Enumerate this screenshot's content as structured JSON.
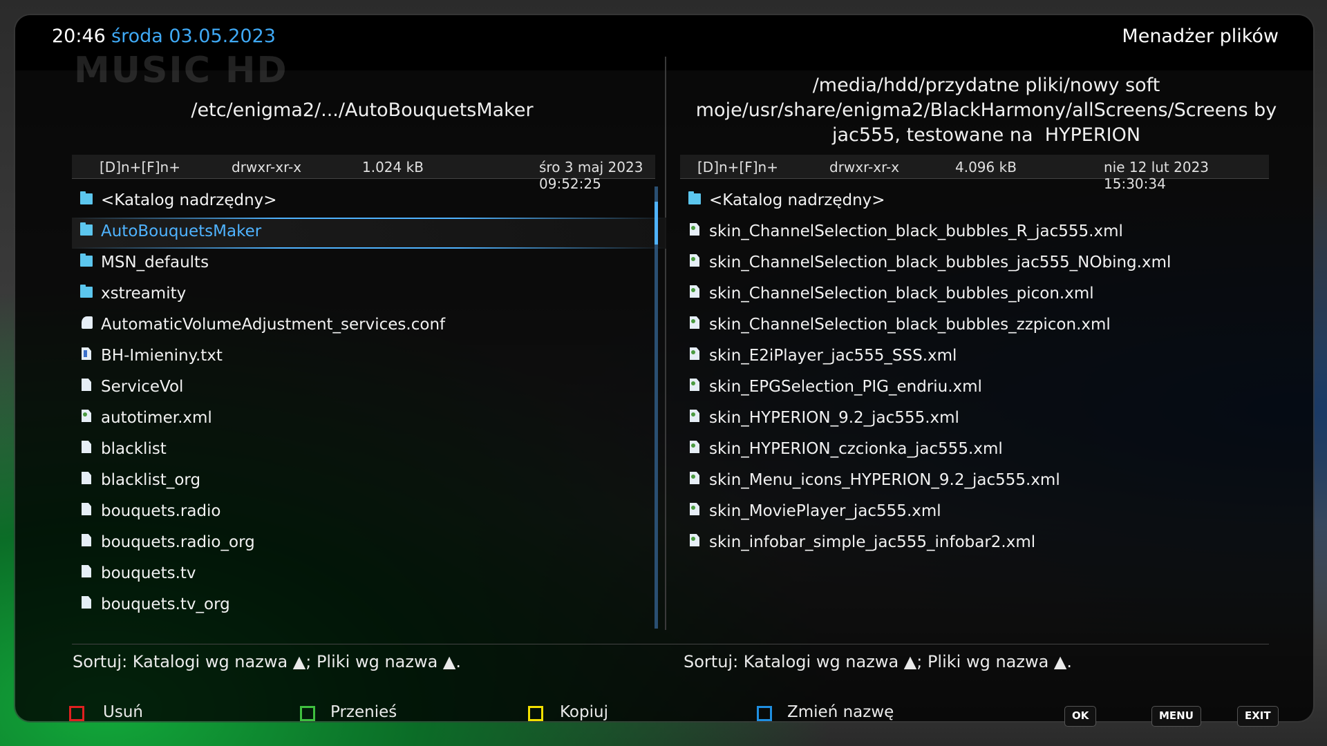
{
  "header": {
    "time": "20:46",
    "date": "środa 03.05.2023",
    "title": "Menadżer plików",
    "watermark": "MUSIC HD"
  },
  "left_pane": {
    "path": "/etc/enigma2/.../AutoBouquetsMaker",
    "info": {
      "type": "[D]n+[F]n+",
      "perms": "drwxr-xr-x",
      "size": "1.024 kB",
      "date": "śro 3 maj 2023 09:52:25"
    },
    "items": [
      {
        "name": "<Katalog nadrzędny>",
        "icon": "folder-icon"
      },
      {
        "name": "AutoBouquetsMaker",
        "icon": "folder-icon",
        "selected": true
      },
      {
        "name": "MSN_defaults",
        "icon": "folder-icon"
      },
      {
        "name": "xstreamity",
        "icon": "folder-icon"
      },
      {
        "name": "AutomaticVolumeAdjustment_services.conf",
        "icon": "config-file-icon"
      },
      {
        "name": "BH-Imieniny.txt",
        "icon": "text-file-icon"
      },
      {
        "name": "ServiceVol",
        "icon": "file-icon"
      },
      {
        "name": "autotimer.xml",
        "icon": "xml-file-icon"
      },
      {
        "name": "blacklist",
        "icon": "file-icon"
      },
      {
        "name": "blacklist_org",
        "icon": "file-icon"
      },
      {
        "name": "bouquets.radio",
        "icon": "file-icon"
      },
      {
        "name": "bouquets.radio_org",
        "icon": "file-icon"
      },
      {
        "name": "bouquets.tv",
        "icon": "file-icon"
      },
      {
        "name": "bouquets.tv_org",
        "icon": "file-icon"
      }
    ],
    "sort": "Sortuj: Katalogi wg nazwa ▲; Pliki wg nazwa ▲."
  },
  "right_pane": {
    "path_lines": [
      "/media/hdd/przydatne pliki/nowy soft",
      "moje/usr/share/enigma2/BlackHarmony/allScreens/Screens by",
      "jac555, testowane na  HYPERION"
    ],
    "info": {
      "type": "[D]n+[F]n+",
      "perms": "drwxr-xr-x",
      "size": "4.096 kB",
      "date": "nie 12 lut 2023 15:30:34"
    },
    "items": [
      {
        "name": "<Katalog nadrzędny>",
        "icon": "folder-icon"
      },
      {
        "name": "skin_ChannelSelection_black_bubbles_R_jac555.xml",
        "icon": "xml-file-icon"
      },
      {
        "name": "skin_ChannelSelection_black_bubbles_jac555_NObing.xml",
        "icon": "xml-file-icon"
      },
      {
        "name": "skin_ChannelSelection_black_bubbles_picon.xml",
        "icon": "xml-file-icon"
      },
      {
        "name": "skin_ChannelSelection_black_bubbles_zzpicon.xml",
        "icon": "xml-file-icon"
      },
      {
        "name": "skin_E2iPlayer_jac555_SSS.xml",
        "icon": "xml-file-icon"
      },
      {
        "name": "skin_EPGSelection_PIG_endriu.xml",
        "icon": "xml-file-icon"
      },
      {
        "name": "skin_HYPERION_9.2_jac555.xml",
        "icon": "xml-file-icon"
      },
      {
        "name": "skin_HYPERION_czcionka_jac555.xml",
        "icon": "xml-file-icon"
      },
      {
        "name": "skin_Menu_icons_HYPERION_9.2_jac555.xml",
        "icon": "xml-file-icon"
      },
      {
        "name": "skin_MoviePlayer_jac555.xml",
        "icon": "xml-file-icon"
      },
      {
        "name": "skin_infobar_simple_jac555_infobar2.xml",
        "icon": "xml-file-icon"
      }
    ],
    "sort": "Sortuj: Katalogi wg nazwa ▲; Pliki wg nazwa ▲."
  },
  "footer": {
    "red_label": "Usuń",
    "green_label": "Przenieś",
    "yellow_label": "Kopiuj",
    "blue_label": "Zmień nazwę",
    "ok_label": "OK",
    "menu_label": "MENU",
    "exit_label": "EXIT",
    "colors": {
      "red": "#e02020",
      "green": "#3fbf3f",
      "yellow": "#f2e000",
      "blue": "#1f8fe0"
    }
  }
}
